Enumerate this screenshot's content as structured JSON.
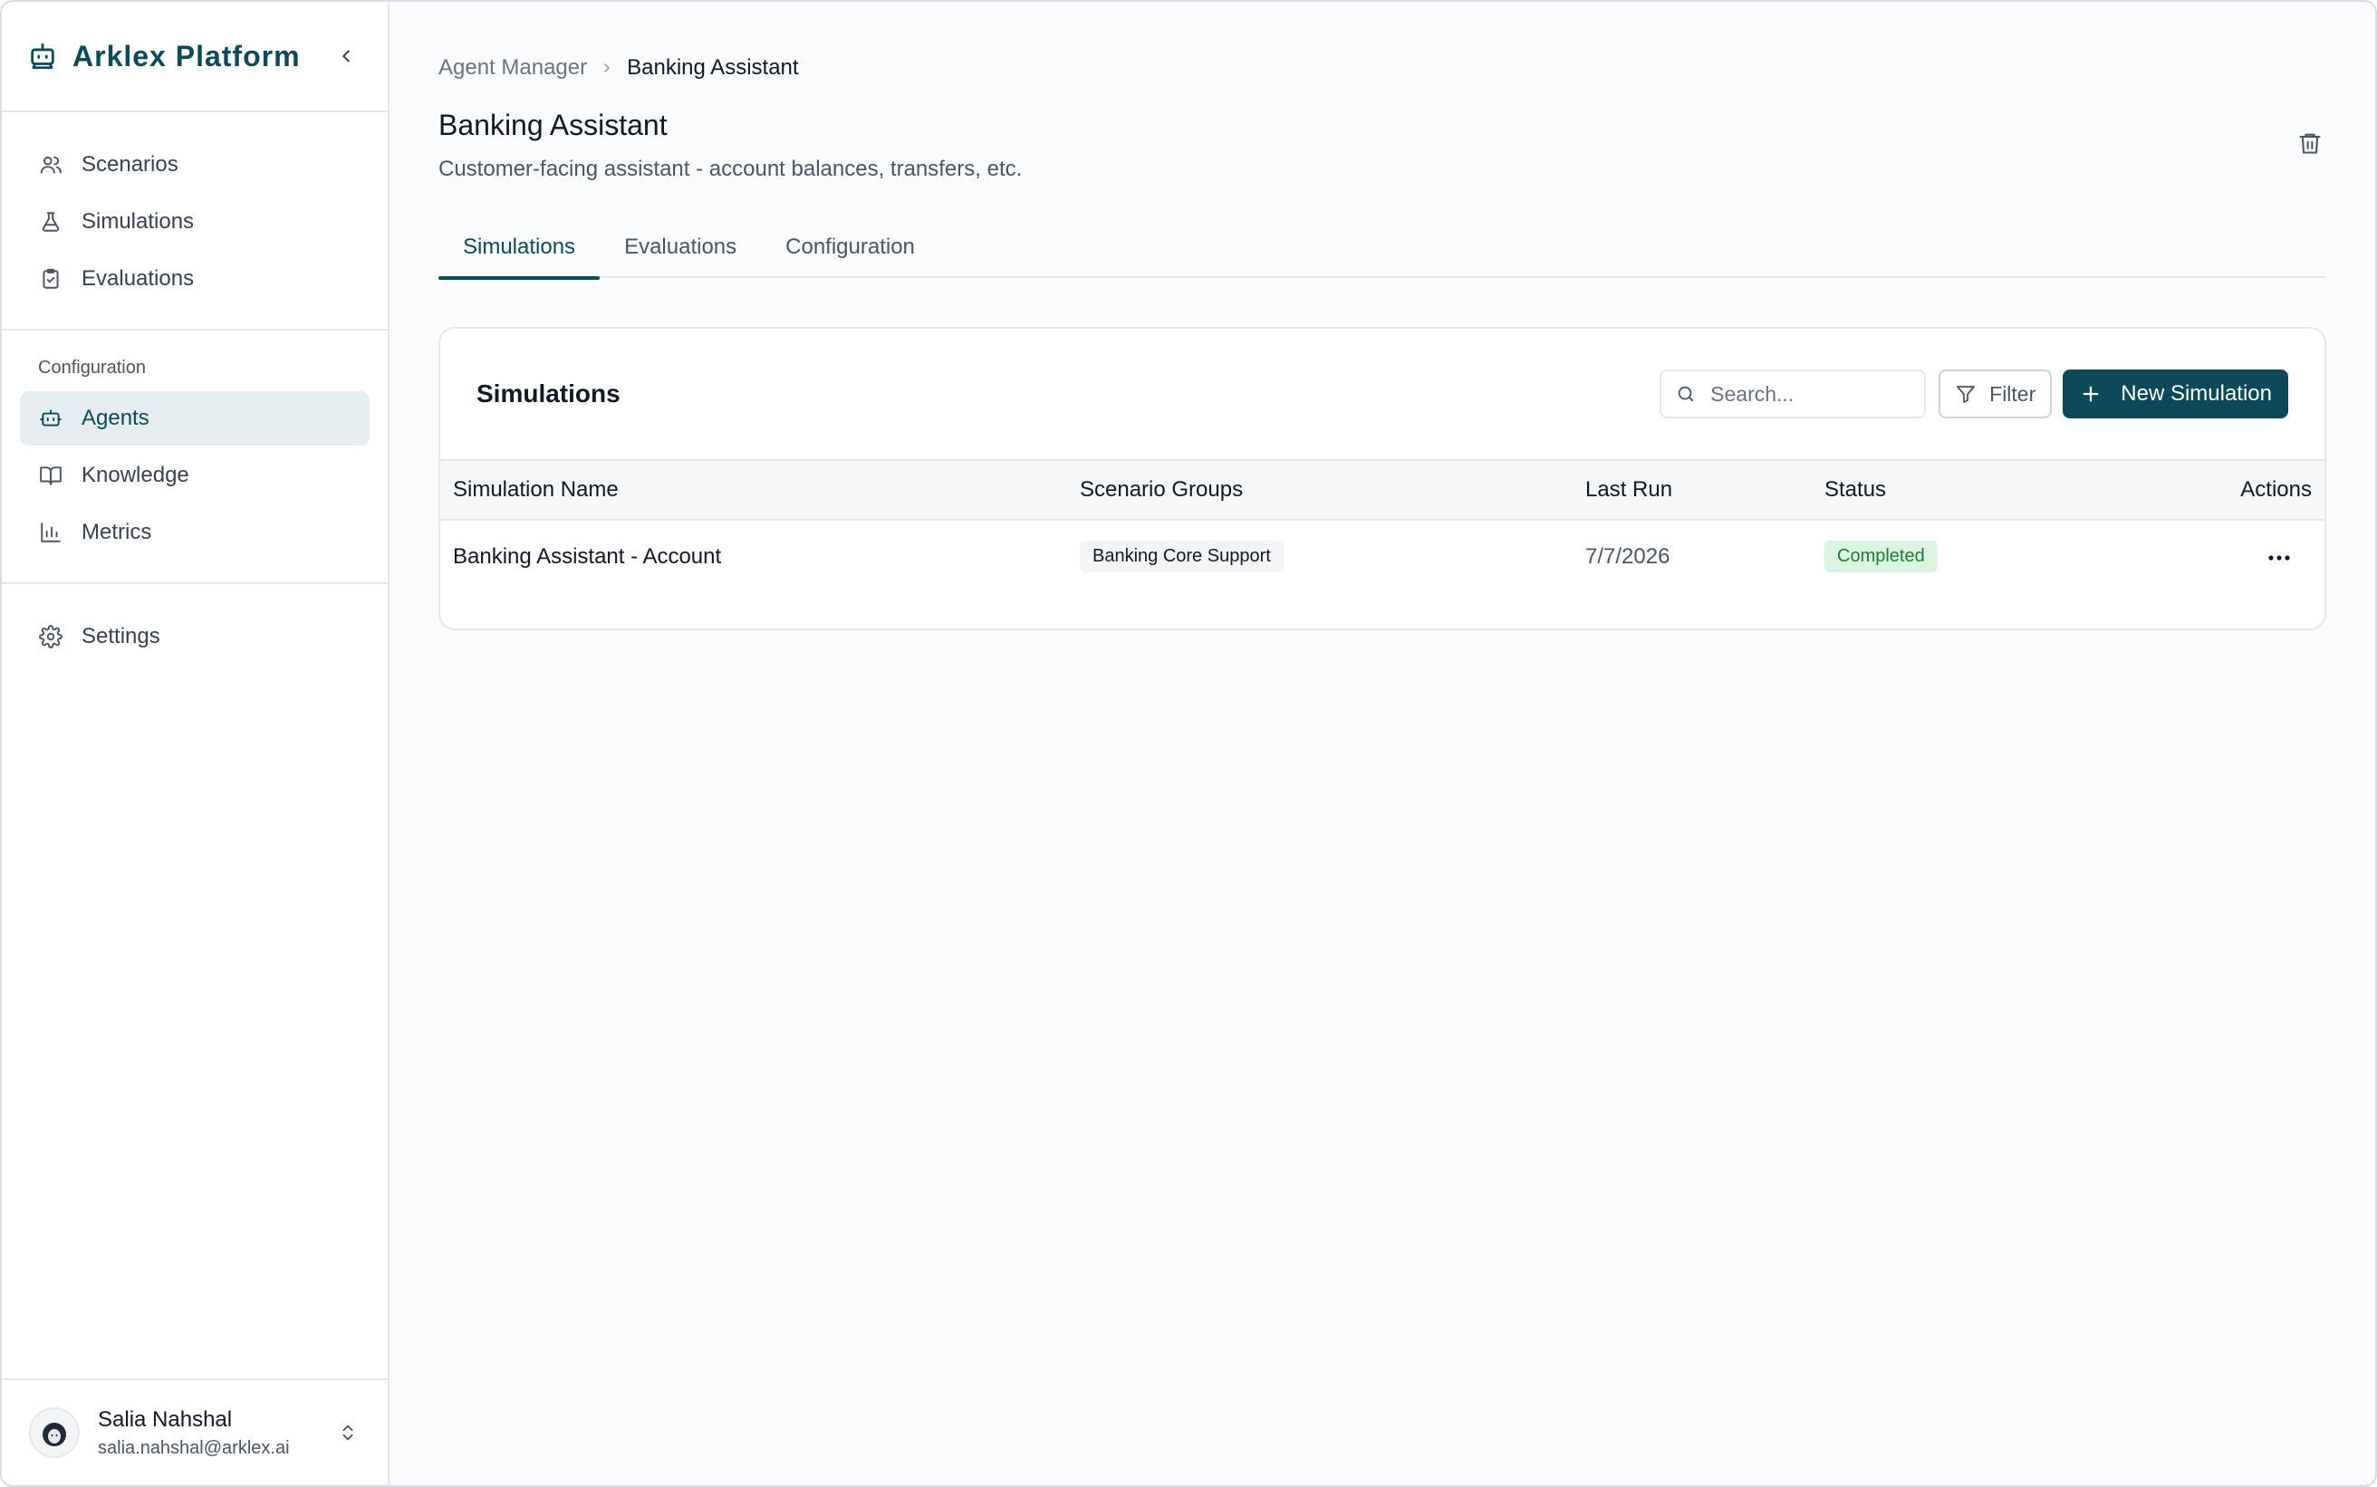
{
  "app": {
    "name": "Arklex Platform"
  },
  "sidebar": {
    "primary": [
      {
        "label": "Scenarios",
        "icon": "users-icon"
      },
      {
        "label": "Simulations",
        "icon": "flask-icon"
      },
      {
        "label": "Evaluations",
        "icon": "clipboard-check-icon"
      }
    ],
    "group_label": "Configuration",
    "config": [
      {
        "label": "Agents",
        "icon": "bot-icon",
        "active": true
      },
      {
        "label": "Knowledge",
        "icon": "book-icon"
      },
      {
        "label": "Metrics",
        "icon": "bar-chart-icon"
      }
    ],
    "settings": {
      "label": "Settings",
      "icon": "gear-icon"
    }
  },
  "user": {
    "name": "Salia Nahshal",
    "email": "salia.nahshal@arklex.ai"
  },
  "breadcrumb": {
    "parent": "Agent Manager",
    "current": "Banking Assistant"
  },
  "page": {
    "title": "Banking Assistant",
    "subtitle": "Customer-facing assistant - account balances, transfers, etc."
  },
  "tabs": [
    {
      "label": "Simulations",
      "active": true
    },
    {
      "label": "Evaluations"
    },
    {
      "label": "Configuration"
    }
  ],
  "card": {
    "title": "Simulations",
    "search_placeholder": "Search...",
    "filter_label": "Filter",
    "new_label": "New Simulation"
  },
  "table": {
    "headers": [
      "Simulation Name",
      "Scenario Groups",
      "Last Run",
      "Status",
      "Actions"
    ],
    "rows": [
      {
        "name": "Banking Assistant - Account",
        "group": "Banking Core Support",
        "last_run": "7/7/2026",
        "status": "Completed"
      }
    ]
  },
  "colors": {
    "brand": "#0c4a5a",
    "active_bg": "#e5edf1",
    "status_bg": "#dcf5e3",
    "status_text": "#1e7a3d"
  }
}
